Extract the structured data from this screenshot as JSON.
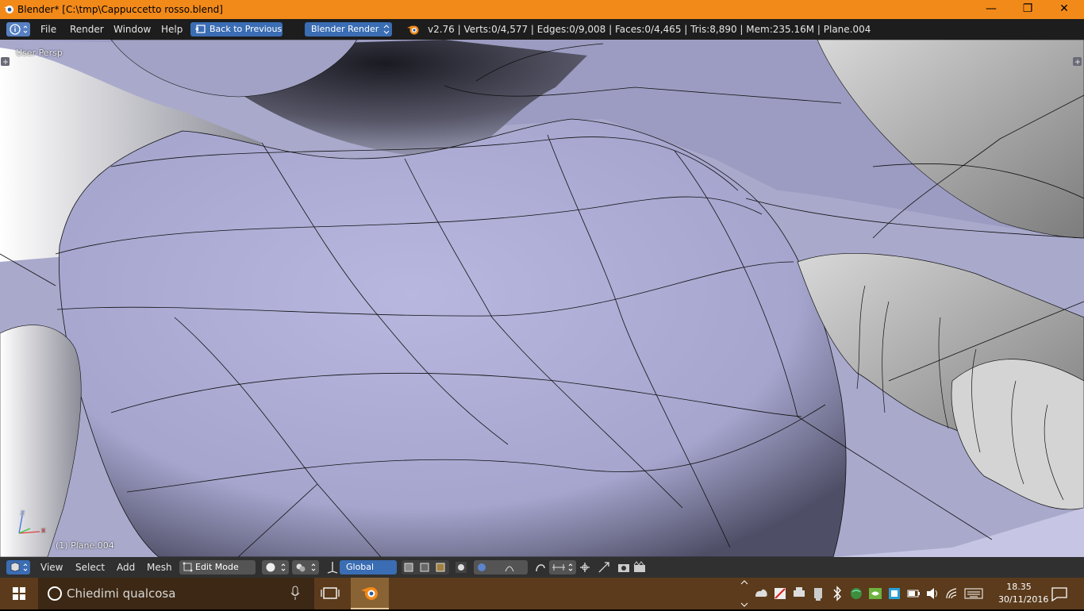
{
  "window": {
    "title": "Blender* [C:\\tmp\\Cappuccetto  rosso.blend]",
    "minimize_glyph": "—",
    "maximize_glyph": "❐",
    "close_glyph": "✕"
  },
  "info_header": {
    "menus": [
      "File",
      "Render",
      "Window",
      "Help"
    ],
    "back_button": "Back to Previous",
    "render_engine": "Blender Render",
    "stats": "v2.76 | Verts:0/4,577 | Edges:0/9,008 | Faces:0/4,465 | Tris:8,890 | Mem:235.16M | Plane.004"
  },
  "viewport": {
    "view_label": "User Persp",
    "object_label": "(1) Plane.004",
    "axis_x": "x",
    "axis_z": "z"
  },
  "view_header": {
    "menus": [
      "View",
      "Select",
      "Add",
      "Mesh"
    ],
    "mode": "Edit Mode",
    "orientation": "Global"
  },
  "taskbar": {
    "search_placeholder": "Chiedimi qualcosa",
    "time": "18.35",
    "date": "30/11/2016"
  },
  "colors": {
    "title_bar": "#f28a1a",
    "header_bg": "#1d1d1d",
    "button_blue": "#3a6db3",
    "mesh_fill": "#a9a9cc",
    "taskbar": "#5b3b1c"
  }
}
